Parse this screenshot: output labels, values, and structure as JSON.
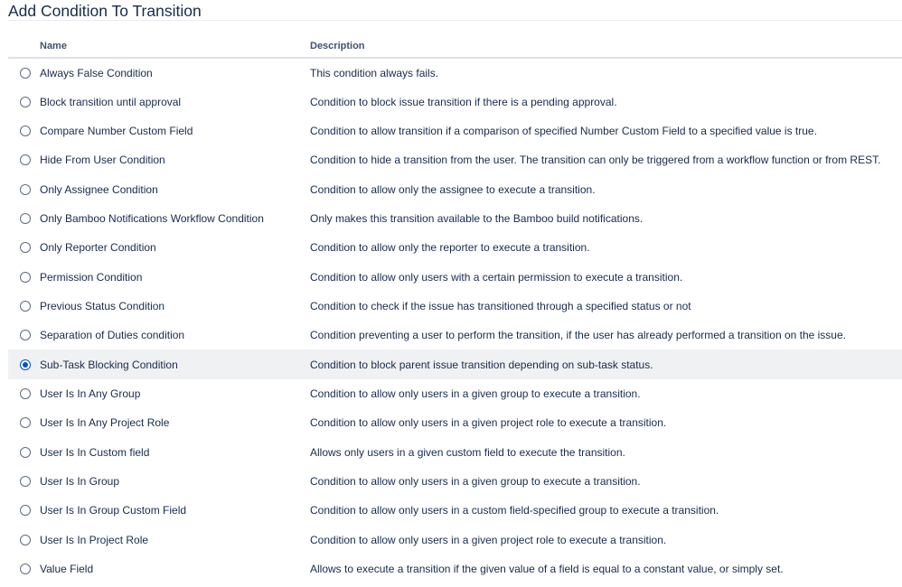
{
  "page": {
    "title": "Add Condition To Transition"
  },
  "table": {
    "columns": {
      "name": "Name",
      "description": "Description"
    },
    "selected_index": 10,
    "colors": {
      "selected_row": "#f0f1f3",
      "radio_checked": "#0052cc",
      "text": "#172b4d"
    },
    "rows": [
      {
        "name": "Always False Condition",
        "description": "This condition always fails.",
        "selected": false
      },
      {
        "name": "Block transition until approval",
        "description": "Condition to block issue transition if there is a pending approval.",
        "selected": false
      },
      {
        "name": "Compare Number Custom Field",
        "description": "Condition to allow transition if a comparison of specified Number Custom Field to a specified value is true.",
        "selected": false
      },
      {
        "name": "Hide From User Condition",
        "description": "Condition to hide a transition from the user. The transition can only be triggered from a workflow function or from REST.",
        "selected": false
      },
      {
        "name": "Only Assignee Condition",
        "description": "Condition to allow only the assignee to execute a transition.",
        "selected": false
      },
      {
        "name": "Only Bamboo Notifications Workflow Condition",
        "description": "Only makes this transition available to the Bamboo build notifications.",
        "selected": false
      },
      {
        "name": "Only Reporter Condition",
        "description": "Condition to allow only the reporter to execute a transition.",
        "selected": false
      },
      {
        "name": "Permission Condition",
        "description": "Condition to allow only users with a certain permission to execute a transition.",
        "selected": false
      },
      {
        "name": "Previous Status Condition",
        "description": "Condition to check if the issue has transitioned through a specified status or not",
        "selected": false
      },
      {
        "name": "Separation of Duties condition",
        "description": "Condition preventing a user to perform the transition, if the user has already performed a transition on the issue.",
        "selected": false
      },
      {
        "name": "Sub-Task Blocking Condition",
        "description": "Condition to block parent issue transition depending on sub-task status.",
        "selected": true
      },
      {
        "name": "User Is In Any Group",
        "description": "Condition to allow only users in a given group to execute a transition.",
        "selected": false
      },
      {
        "name": "User Is In Any Project Role",
        "description": "Condition to allow only users in a given project role to execute a transition.",
        "selected": false
      },
      {
        "name": "User Is In Custom field",
        "description": "Allows only users in a given custom field to execute the transition.",
        "selected": false
      },
      {
        "name": "User Is In Group",
        "description": "Condition to allow only users in a given group to execute a transition.",
        "selected": false
      },
      {
        "name": "User Is In Group Custom Field",
        "description": "Condition to allow only users in a custom field-specified group to execute a transition.",
        "selected": false
      },
      {
        "name": "User Is In Project Role",
        "description": "Condition to allow only users in a given project role to execute a transition.",
        "selected": false
      },
      {
        "name": "Value Field",
        "description": "Allows to execute a transition if the given value of a field is equal to a constant value, or simply set.",
        "selected": false
      }
    ]
  }
}
